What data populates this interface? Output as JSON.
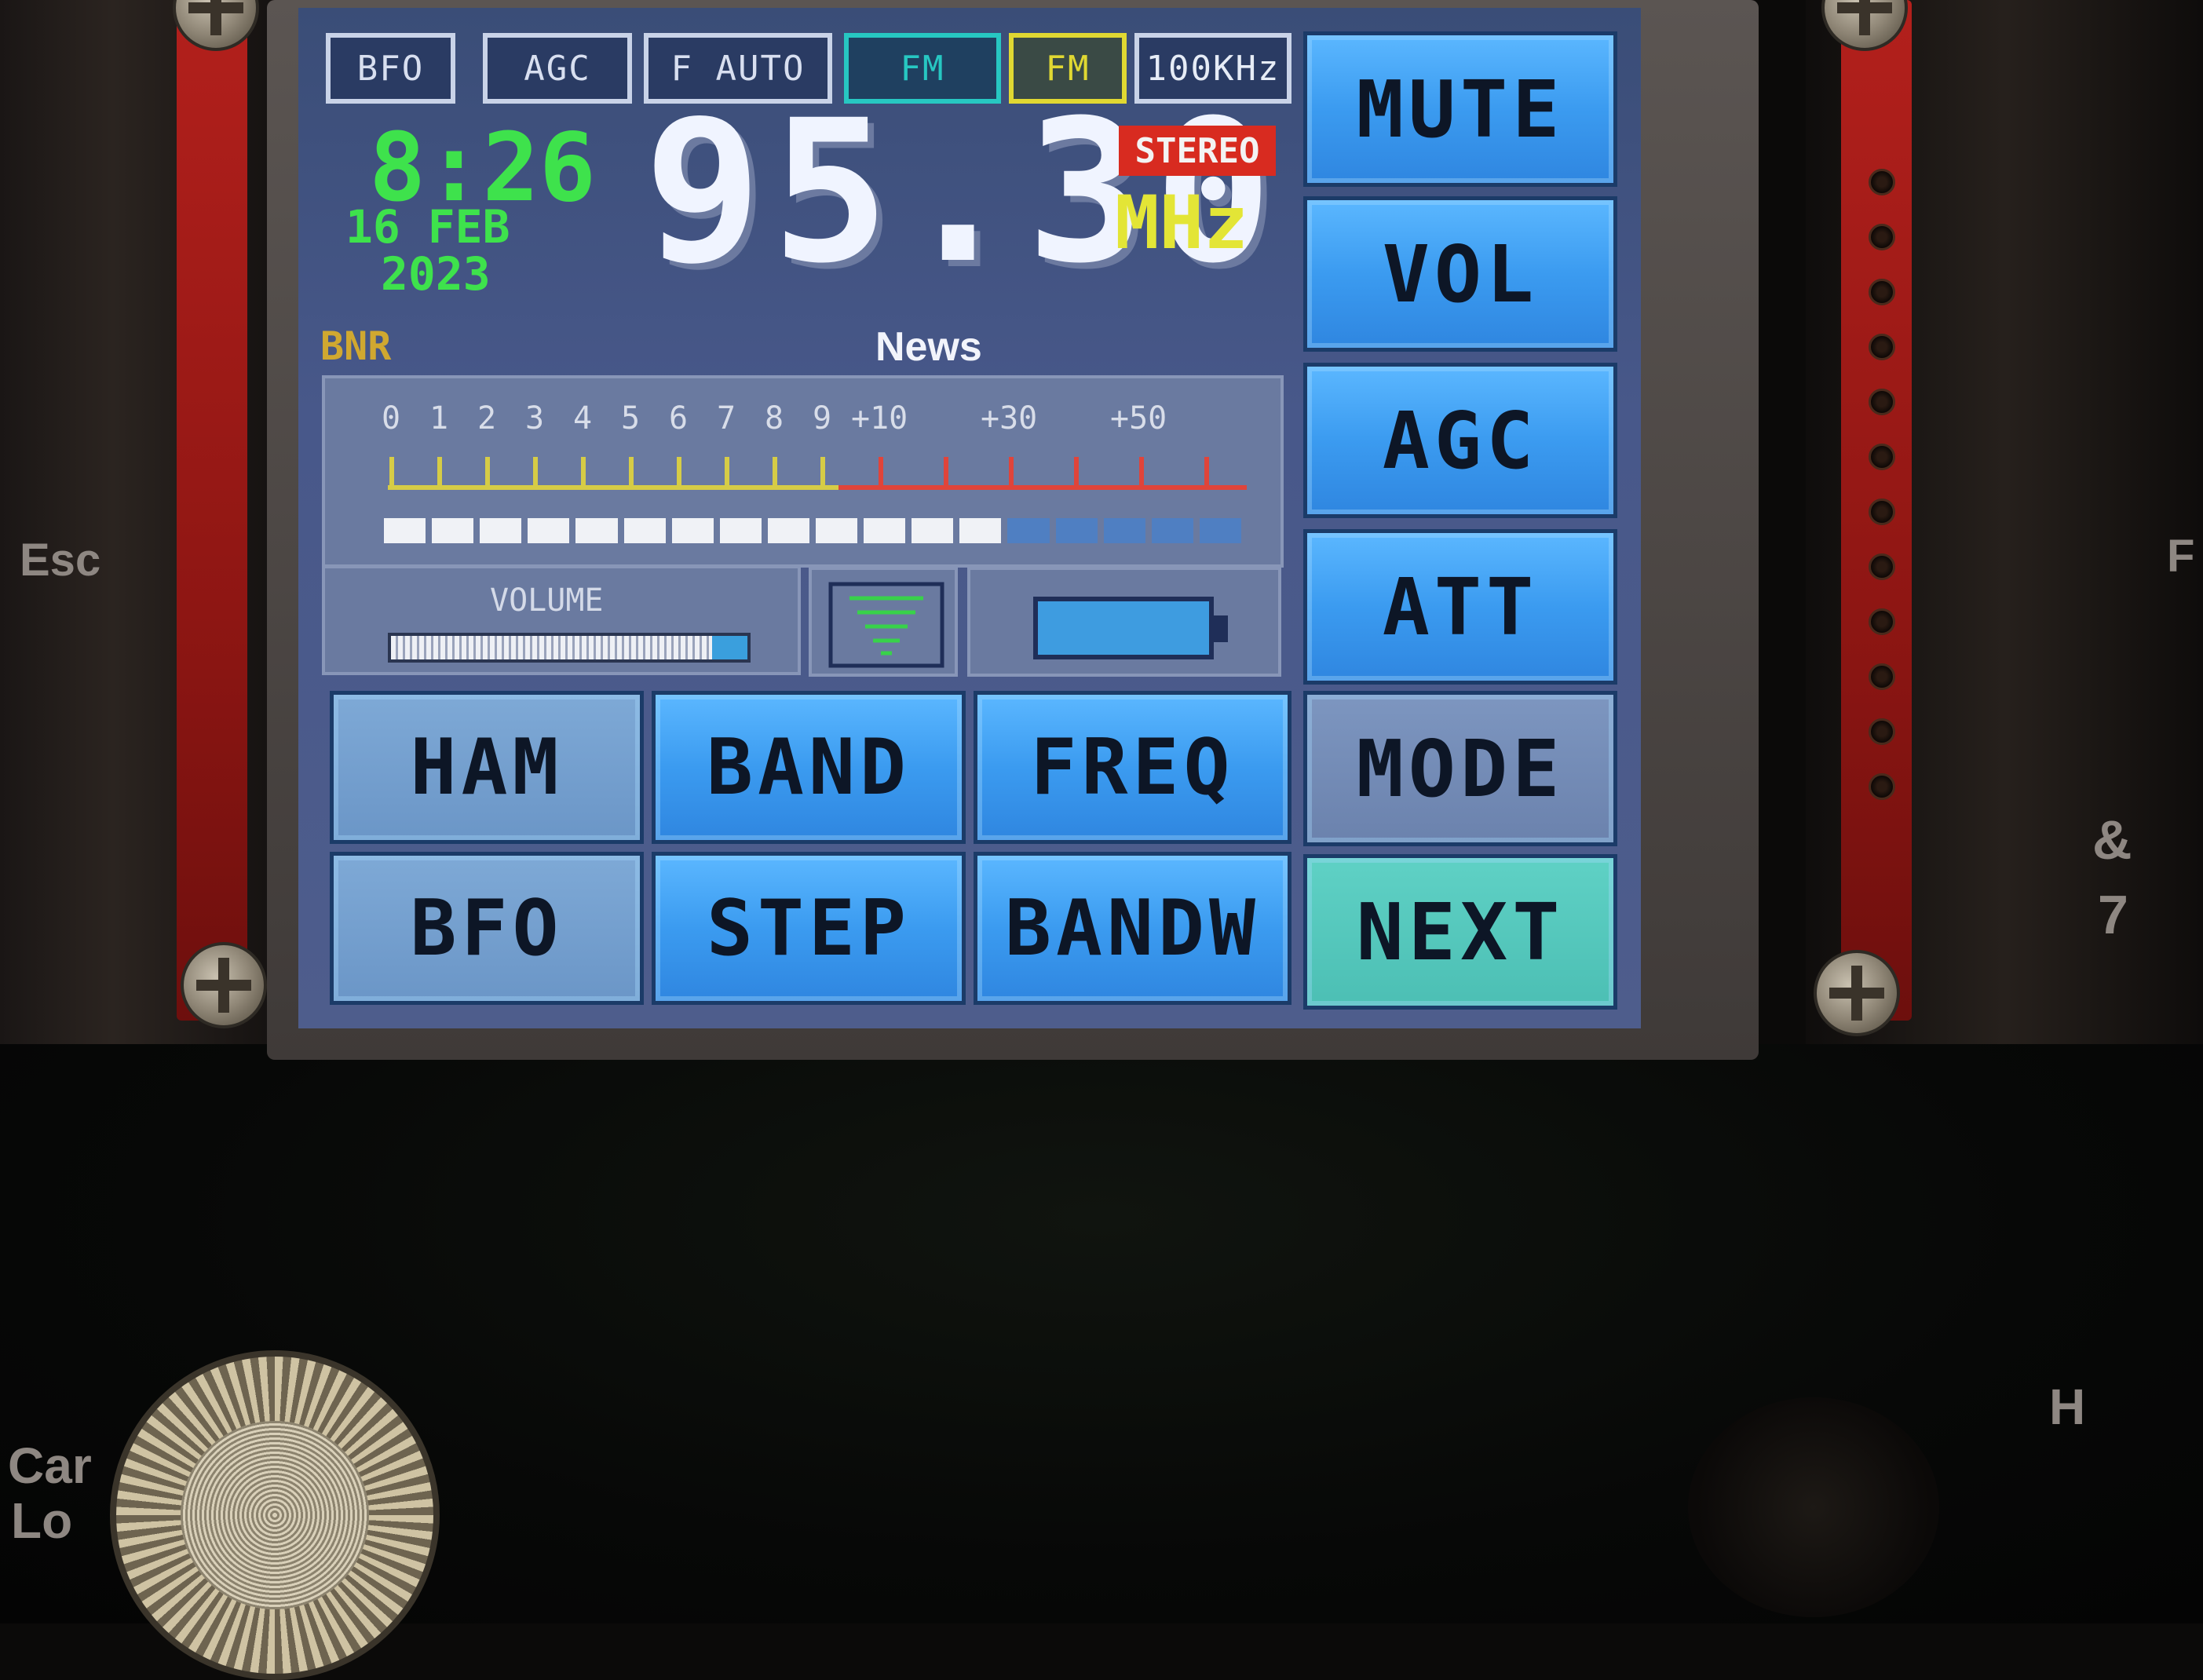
{
  "status_bar": {
    "bfo": "BFO",
    "agc": "AGC",
    "f_auto": "F AUTO",
    "mode1": "FM",
    "mode2": "FM",
    "step": "100KHz"
  },
  "clock": {
    "time": "8:26",
    "date": "16 FEB",
    "year": "2023"
  },
  "frequency": {
    "value": "95.30",
    "unit": "MHz",
    "stereo": "STEREO"
  },
  "rds": {
    "bnr": "BNR",
    "program_type": "News"
  },
  "signal_meter": {
    "scale": [
      "0",
      "1",
      "2",
      "3",
      "4",
      "5",
      "6",
      "7",
      "8",
      "9",
      "+10",
      "+30",
      "+50"
    ],
    "level_segments_lit": 13,
    "level_segments_total": 18
  },
  "volume": {
    "label": "VOLUME",
    "level": 0.9
  },
  "battery": {
    "level": 1.0
  },
  "side_buttons": [
    "MUTE",
    "VOL",
    "AGC",
    "ATT",
    "MODE",
    "NEXT"
  ],
  "grid_buttons": {
    "row1": [
      "HAM",
      "BAND",
      "FREQ"
    ],
    "row2": [
      "BFO",
      "STEP",
      "BANDW"
    ]
  },
  "device_labels": {
    "esc": "Esc",
    "car": "Car",
    "lo": "Lo",
    "seven": "7",
    "amp": "&",
    "h": "H",
    "f": "F"
  },
  "colors": {
    "button_blue": "#3b9bf0",
    "clock_green": "#3ee24c",
    "mhz_yellow": "#e3e536",
    "stereo_red": "#d82b20",
    "fm_cyan": "#27c7c2"
  }
}
